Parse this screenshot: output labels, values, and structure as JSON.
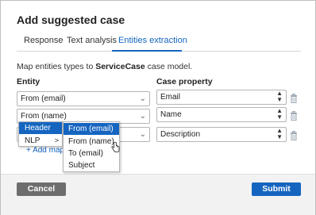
{
  "dialog": {
    "title": "Add suggested case"
  },
  "tabs": [
    {
      "label": "Response"
    },
    {
      "label": "Text analysis"
    },
    {
      "label": "Entities extraction"
    }
  ],
  "description": {
    "prefix": "Map entities types to ",
    "model": "ServiceCase",
    "suffix": " case model."
  },
  "columns": {
    "entity": "Entity",
    "property": "Case property"
  },
  "rows": [
    {
      "entity": "From (email)",
      "property": "Email"
    },
    {
      "entity": "From (name)",
      "property": "Name"
    },
    {
      "entity": "",
      "property": "Description"
    }
  ],
  "add_mapping": "+ Add map",
  "menu_level1": [
    {
      "label": "Header",
      "arrow": ""
    },
    {
      "label": "NLP",
      "arrow": ">"
    }
  ],
  "menu_level2": [
    {
      "label": "From (email)"
    },
    {
      "label": "From (name)"
    },
    {
      "label": "To (email)"
    },
    {
      "label": "Subject"
    }
  ],
  "footer": {
    "cancel_label": "Cancel",
    "submit_label": "Submit"
  },
  "colors": {
    "accent": "#1565c0",
    "cancel": "#6d6d6d"
  }
}
